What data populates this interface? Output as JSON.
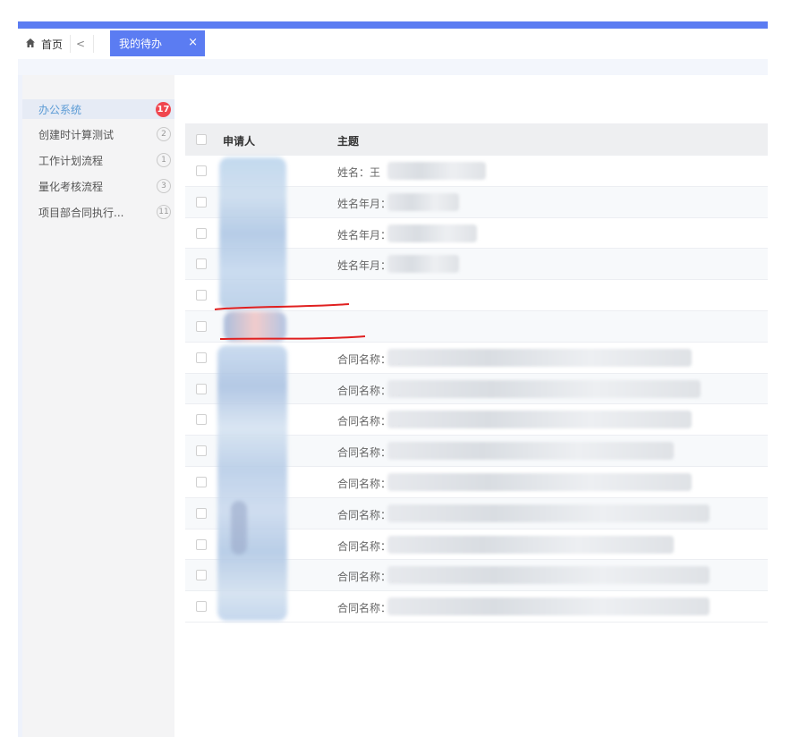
{
  "tabs": {
    "home_label": "首页",
    "back_glyph": "<",
    "active_label": "我的待办",
    "close_glyph": "×"
  },
  "sidebar": {
    "items": [
      {
        "label": "办公系统",
        "count": "17",
        "active": true
      },
      {
        "label": "创建时计算测试",
        "count": "2"
      },
      {
        "label": "工作计划流程",
        "count": "1"
      },
      {
        "label": "量化考核流程",
        "count": "3"
      },
      {
        "label": "项目部合同执行...",
        "count": "11"
      }
    ]
  },
  "table": {
    "headers": {
      "applicant": "申请人",
      "subject": "主题"
    },
    "rows": [
      {
        "subject": "姓名：王"
      },
      {
        "subject": "姓名年月："
      },
      {
        "subject": "姓名年月："
      },
      {
        "subject": "姓名年月："
      },
      {
        "subject": ""
      },
      {
        "subject": ""
      },
      {
        "subject": "合同名称：甬"
      },
      {
        "subject": "合同名称：甬"
      },
      {
        "subject": "合同名称：甬"
      },
      {
        "subject": "合同名称：华"
      },
      {
        "subject": "合同名称："
      },
      {
        "subject": "合同名称：崖"
      },
      {
        "subject": "合同名称：中"
      },
      {
        "subject": "合同名称：固"
      },
      {
        "subject": "合同名称："
      }
    ]
  },
  "colors": {
    "accent": "#5b7cf2",
    "badge_red": "#f0464f",
    "annotation_red": "#e02020"
  }
}
